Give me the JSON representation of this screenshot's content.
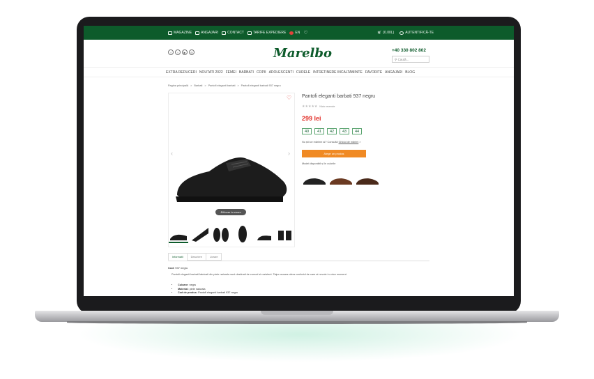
{
  "topbar": {
    "links": [
      "MAGAZINE",
      "ANGAJARI",
      "CONTACT",
      "TARIFE EXPEDIERE",
      "EN"
    ],
    "cart": "(0.00L)",
    "auth": "AUTENTIFICĂ-TE"
  },
  "header": {
    "logo": "Marelbo",
    "phone": "+40 330 802 802",
    "search_placeholder": "Caută..."
  },
  "nav": [
    "EXTRA REDUCERI",
    "NOUTATI 2022",
    "FEMEI",
    "BARBATI",
    "COPII",
    "ADOLESCENTI",
    "CURELE",
    "INTRETINERE INCALTAMINTE",
    "FAVORITE",
    "ANGAJARI",
    "BLOG"
  ],
  "breadcrumb": [
    "Pagina principală",
    "Barbati",
    "Pantofi eleganti barbati",
    "Pantofi eleganti barbati 937 negru"
  ],
  "product": {
    "title": "Pantofi eleganti barbati 937 negru",
    "reviews": "Nicio recenzie",
    "price": "299 lei",
    "sizes": [
      "40",
      "41",
      "42",
      "43",
      "44"
    ],
    "size_help": "Nu știi ce mărime ai? Consultă",
    "size_guide": "Ghidul de mărimi",
    "add_to_cart": "Alege un produs",
    "colors_label": "Model disponibil și în culorile",
    "zoom_label": "Hover to zoom"
  },
  "tabs": [
    "Informatii",
    "Descriere",
    "Livrare"
  ],
  "details": {
    "code_label": "Cod:",
    "code": "937 negru",
    "description": "Pantofi eleganti barbati fabricati din piele naturala sunt destinati de comod si rezistent. Talpa usoara ofera confortul de care ai nevoie in orice moment.",
    "specs": [
      {
        "k": "Culoare:",
        "v": "negru"
      },
      {
        "k": "Material:",
        "v": "piele naturala"
      },
      {
        "k": "Cod de produs:",
        "v": "Pantofi eleganti barbati 937 negru"
      }
    ]
  },
  "colors": {
    "brand": "#0d5b2b",
    "accent": "#f08a24",
    "price": "#e2312a"
  }
}
